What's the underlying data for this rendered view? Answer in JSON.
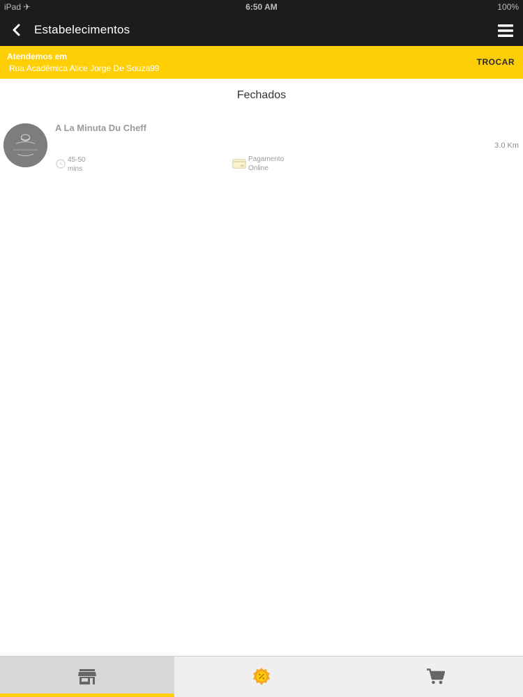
{
  "status_bar": {
    "carrier": "iPad ✈",
    "time": "6:50 AM",
    "battery": "100%"
  },
  "nav": {
    "title": "Estabelecimentos",
    "back_icon": "chevron-left-icon",
    "menu_icon": "hamburger-menu-icon"
  },
  "banner": {
    "label": "Atendemos em",
    "address": "Rua Acadêmica Alice Jorge De Souza99",
    "change_label": "TROCAR",
    "background_color": "#fecf06"
  },
  "section": {
    "title": "Fechados"
  },
  "restaurants": [
    {
      "name": "A La Minuta Du Cheff",
      "logo_text": "A La Minuta Du Cheff",
      "distance": "3.0 Km",
      "time_line1": "45-50",
      "time_line2": "mins",
      "payment_line1": "Pagamento",
      "payment_line2": "Online"
    }
  ],
  "tabs": [
    {
      "id": "stores",
      "icon": "store-icon",
      "selected": true
    },
    {
      "id": "promotions",
      "icon": "discount-badge-icon",
      "selected": false
    },
    {
      "id": "cart",
      "icon": "cart-icon",
      "selected": false
    }
  ],
  "colors": {
    "accent": "#fecf06",
    "navbar": "#1c1c1c"
  }
}
